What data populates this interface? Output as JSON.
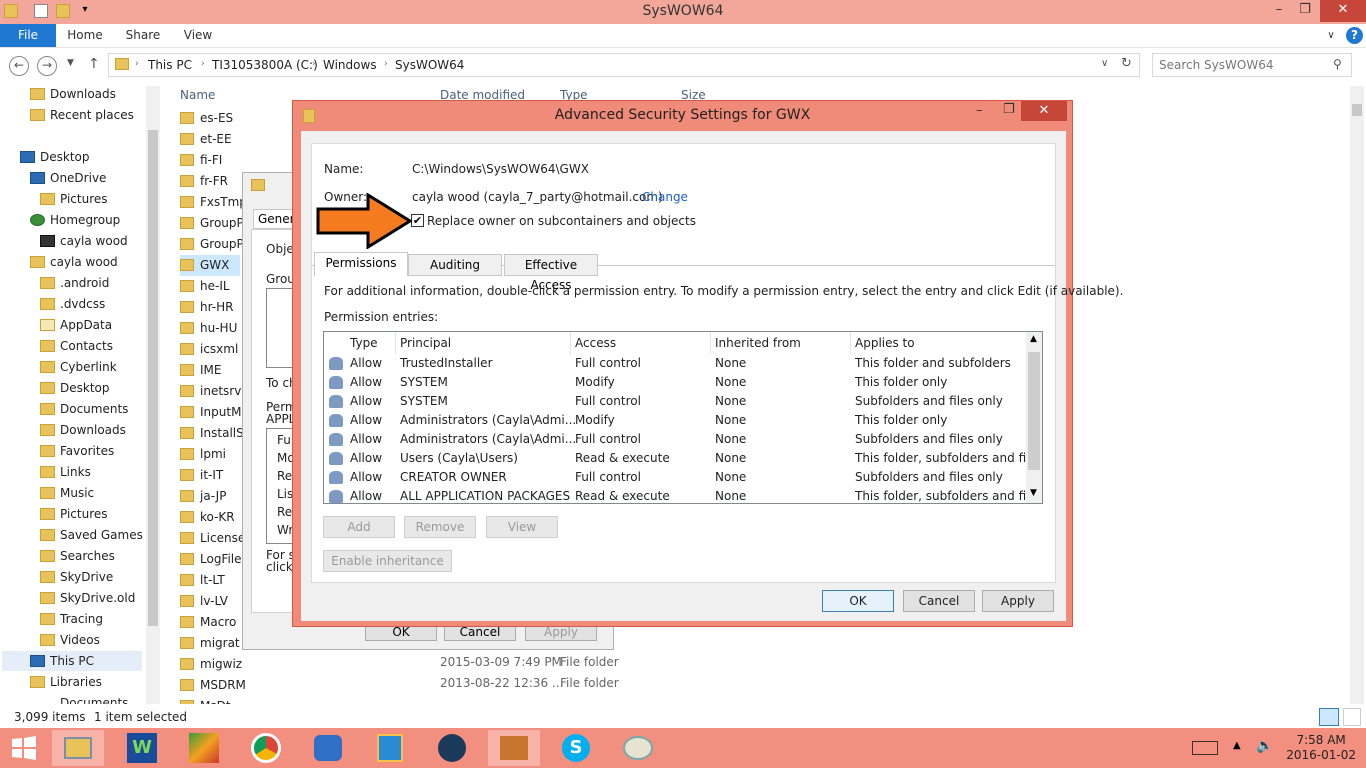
{
  "window": {
    "title": "SysWOW64",
    "minimize": "–",
    "maximize": "❐",
    "close": "✕"
  },
  "ribbon": {
    "tabs": [
      "File",
      "Home",
      "Share",
      "View"
    ],
    "help": "?"
  },
  "address": {
    "breadcrumbs": [
      "This PC",
      "TI31053800A (C:)",
      "Windows",
      "SysWOW64"
    ],
    "search_placeholder": "Search SysWOW64"
  },
  "nav_pane": {
    "items": [
      "Downloads",
      "Recent places",
      "Desktop",
      "OneDrive",
      "Pictures",
      "Homegroup",
      "cayla wood",
      "cayla wood",
      ".android",
      ".dvdcss",
      "AppData",
      "Contacts",
      "Cyberlink",
      "Desktop",
      "Documents",
      "Downloads",
      "Favorites",
      "Links",
      "Music",
      "Pictures",
      "Saved Games",
      "Searches",
      "SkyDrive",
      "SkyDrive.old",
      "Tracing",
      "Videos",
      "This PC",
      "Libraries",
      "Documents"
    ]
  },
  "file_list": {
    "headers": {
      "name": "Name",
      "date": "Date modified",
      "type": "Type",
      "size": "Size"
    },
    "rows": [
      "es-ES",
      "et-EE",
      "fi-FI",
      "fr-FR",
      "FxsTmp",
      "GroupP",
      "GroupP",
      "GWX",
      "he-IL",
      "hr-HR",
      "hu-HU",
      "icsxml",
      "IME",
      "inetsrv",
      "InputM",
      "InstallS",
      "lpmi",
      "it-IT",
      "ja-JP",
      "ko-KR",
      "License",
      "LogFile",
      "lt-LT",
      "lv-LV",
      "Macro",
      "migrat",
      "migwiz",
      "MSDRM",
      "MsDt"
    ],
    "detail_rows": [
      {
        "date": "2015-03-09 7:49 PM",
        "type": "File folder"
      },
      {
        "date": "2013-08-22 12:36 ...",
        "type": "File folder"
      }
    ]
  },
  "status": {
    "items": "3,099 items",
    "selected": "1 item selected"
  },
  "properties_dialog": {
    "tab": "General",
    "fragments": [
      "Objec",
      "Group",
      "To ch",
      "Permi",
      "APPL",
      "Ful",
      "Mo",
      "Re",
      "List",
      "Re",
      "Wri",
      "For sp",
      "click"
    ],
    "ok": "OK",
    "cancel": "Cancel",
    "apply": "Apply"
  },
  "advanced_dialog": {
    "title": "Advanced Security Settings for GWX",
    "name_label": "Name:",
    "name_value": "C:\\Windows\\SysWOW64\\GWX",
    "owner_label": "Owner:",
    "owner_value": "cayla wood (cayla_7_party@hotmail.com)",
    "change_link": "Change",
    "replace_owner_label": "Replace owner on subcontainers and objects",
    "replace_owner_checked": true,
    "tabs": [
      "Permissions",
      "Auditing",
      "Effective Access"
    ],
    "info_text": "For additional information, double-click a permission entry. To modify a permission entry, select the entry and click Edit (if available).",
    "entries_label": "Permission entries:",
    "columns": [
      "Type",
      "Principal",
      "Access",
      "Inherited from",
      "Applies to"
    ],
    "entries": [
      {
        "type": "Allow",
        "principal": "TrustedInstaller",
        "access": "Full control",
        "inherited": "None",
        "applies": "This folder and subfolders"
      },
      {
        "type": "Allow",
        "principal": "SYSTEM",
        "access": "Modify",
        "inherited": "None",
        "applies": "This folder only"
      },
      {
        "type": "Allow",
        "principal": "SYSTEM",
        "access": "Full control",
        "inherited": "None",
        "applies": "Subfolders and files only"
      },
      {
        "type": "Allow",
        "principal": "Administrators (Cayla\\Admi...",
        "access": "Modify",
        "inherited": "None",
        "applies": "This folder only"
      },
      {
        "type": "Allow",
        "principal": "Administrators (Cayla\\Admi...",
        "access": "Full control",
        "inherited": "None",
        "applies": "Subfolders and files only"
      },
      {
        "type": "Allow",
        "principal": "Users (Cayla\\Users)",
        "access": "Read & execute",
        "inherited": "None",
        "applies": "This folder, subfolders and files"
      },
      {
        "type": "Allow",
        "principal": "CREATOR OWNER",
        "access": "Full control",
        "inherited": "None",
        "applies": "Subfolders and files only"
      },
      {
        "type": "Allow",
        "principal": "ALL APPLICATION PACKAGES",
        "access": "Read & execute",
        "inherited": "None",
        "applies": "This folder, subfolders and files"
      }
    ],
    "buttons": {
      "add": "Add",
      "remove": "Remove",
      "view": "View",
      "enable_inheritance": "Enable inheritance",
      "ok": "OK",
      "cancel": "Cancel",
      "apply": "Apply"
    }
  },
  "taskbar": {
    "apps": [
      "start-icon",
      "file-explorer-icon",
      "wordperfect-icon",
      "paint-shop-icon",
      "chrome-icon",
      "malwarebytes-icon",
      "media-player-icon",
      "video-editor-icon",
      "app-icon",
      "skype-icon",
      "paint-icon"
    ],
    "time": "7:58 AM",
    "date": "2016-01-02"
  },
  "colors": {
    "title_bar": "#f3a79a",
    "dialog_frame": "#f08a79",
    "accent": "#1f78d1",
    "arrow": "#f47b20"
  }
}
